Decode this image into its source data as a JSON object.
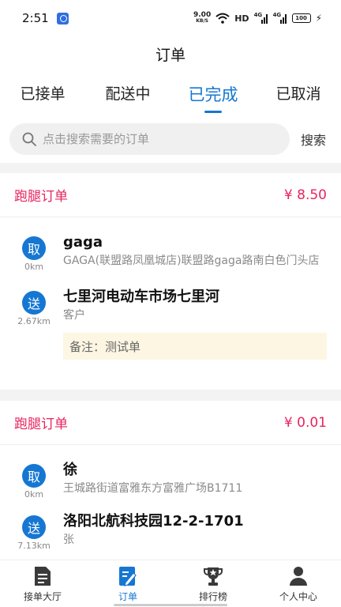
{
  "status_bar": {
    "time": "2:51",
    "net_speed_value": "9.00",
    "net_speed_unit": "KB/S",
    "hd": "HD",
    "signal1": "4G",
    "signal2": "4G",
    "battery": "100"
  },
  "header": {
    "title": "订单"
  },
  "tabs": [
    {
      "label": "已接单",
      "active": false
    },
    {
      "label": "配送中",
      "active": false
    },
    {
      "label": "已完成",
      "active": true
    },
    {
      "label": "已取消",
      "active": false
    }
  ],
  "search": {
    "placeholder": "点击搜索需要的订单",
    "button_label": "搜索"
  },
  "orders": [
    {
      "type": "跑腿订单",
      "price": "¥ 8.50",
      "pickup": {
        "badge": "取",
        "distance": "0km",
        "name": "gaga",
        "address": "GAGA(联盟路凤凰城店)联盟路gaga路南白色门头店"
      },
      "dropoff": {
        "badge": "送",
        "distance": "2.67km",
        "name": "七里河电动车市场七里河",
        "address": "客户"
      },
      "remark": "备注：测试单"
    },
    {
      "type": "跑腿订单",
      "price": "¥ 0.01",
      "pickup": {
        "badge": "取",
        "distance": "0km",
        "name": "徐",
        "address": "王城路街道富雅东方富雅广场B1711"
      },
      "dropoff": {
        "badge": "送",
        "distance": "7.13km",
        "name": "洛阳北航科技园12-2-1701",
        "address": "张"
      }
    }
  ],
  "bottom_nav": [
    {
      "label": "接单大厅",
      "icon": "document-icon",
      "active": false
    },
    {
      "label": "订单",
      "icon": "order-edit-icon",
      "active": true
    },
    {
      "label": "排行榜",
      "icon": "trophy-icon",
      "active": false
    },
    {
      "label": "个人中心",
      "icon": "person-icon",
      "active": false
    }
  ],
  "colors": {
    "accent": "#1677d2",
    "price": "#e8245d",
    "remark_bg": "#fdf6e3"
  }
}
